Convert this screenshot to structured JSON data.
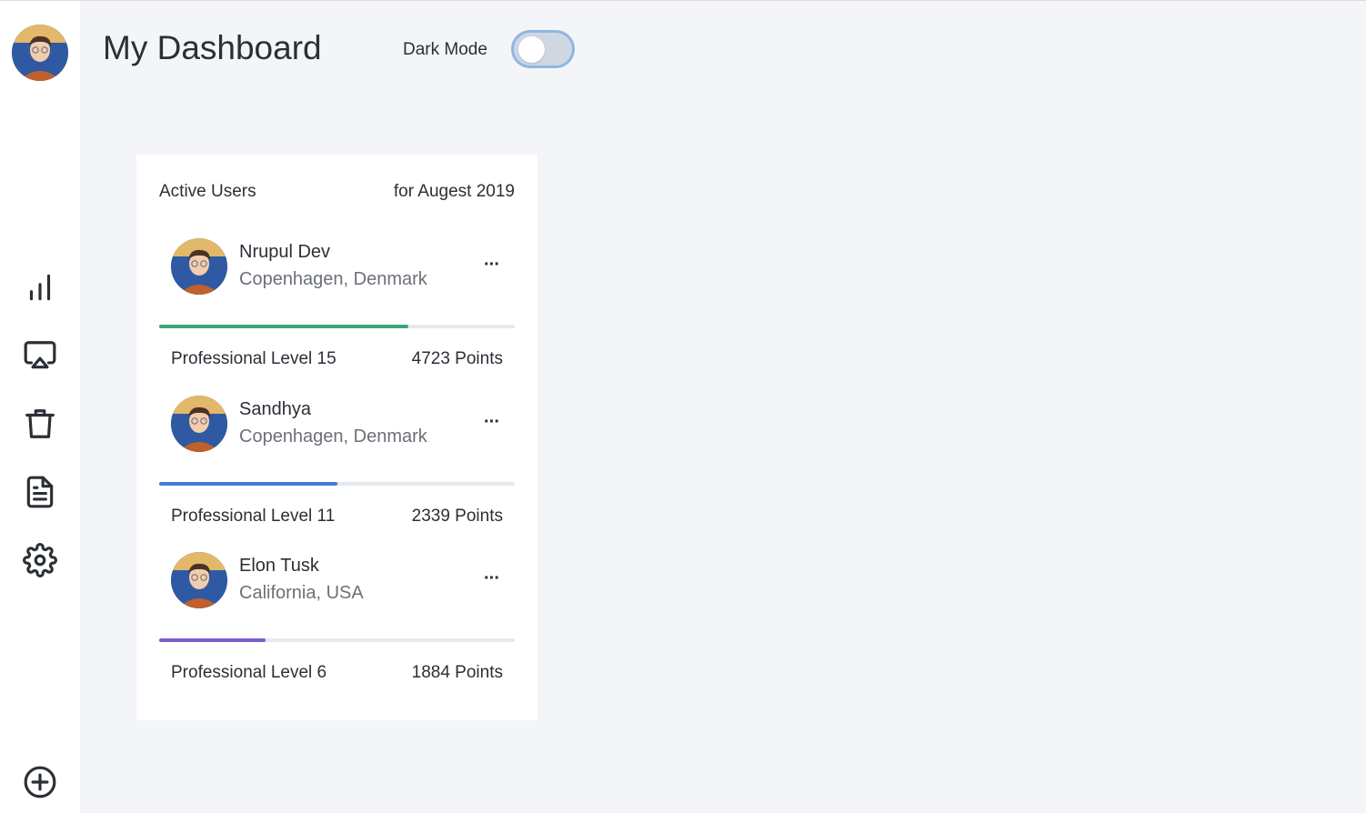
{
  "header": {
    "title": "My Dashboard",
    "dark_mode_label": "Dark Mode",
    "dark_mode_on": false
  },
  "sidebar": {
    "icons": [
      "bar-chart-icon",
      "cast-icon",
      "trash-icon",
      "document-icon",
      "settings-icon",
      "add-circle-icon"
    ]
  },
  "card": {
    "title": "Active Users",
    "period": "for Augest 2019",
    "users": [
      {
        "name": "Nrupul Dev",
        "location": "Copenhagen, Denmark",
        "more": "···",
        "level": "Professional Level 15",
        "points": "4723 Points",
        "progress": 0.7,
        "color": "#3aa776"
      },
      {
        "name": "Sandhya",
        "location": "Copenhagen, Denmark",
        "more": "···",
        "level": "Professional Level 11",
        "points": "2339 Points",
        "progress": 0.5,
        "color": "#3f7fcf"
      },
      {
        "name": "Elon Tusk",
        "location": "California, USA",
        "more": "···",
        "level": "Professional Level 6",
        "points": "1884 Points",
        "progress": 0.3,
        "color": "#7d5bd0"
      }
    ]
  }
}
